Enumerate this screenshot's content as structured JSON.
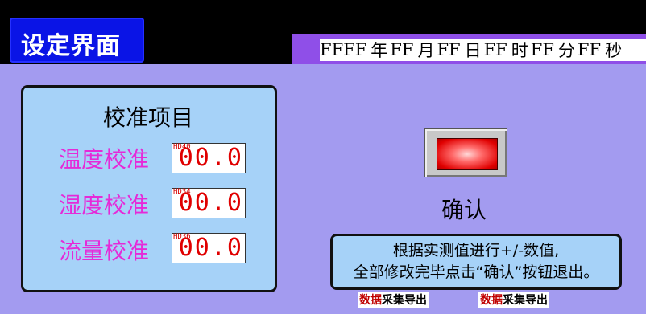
{
  "header": {
    "title": "设定界面"
  },
  "datetime": {
    "year": "FFFF",
    "year_unit": "年",
    "month": "FF",
    "month_unit": "月",
    "day": "FF",
    "day_unit": "日",
    "hour": "FF",
    "hour_unit": "时",
    "minute": "FF",
    "minute_unit": "分",
    "second": "FF",
    "second_unit": "秒"
  },
  "calibration": {
    "title": "校准项目",
    "items": [
      {
        "label": "温度校准",
        "tag": "HD40",
        "value": "00.0"
      },
      {
        "label": "湿度校准",
        "tag": "HD34",
        "value": "00.0"
      },
      {
        "label": "流量校准",
        "tag": "HD36",
        "value": "00.0"
      }
    ]
  },
  "confirm": {
    "label": "确认"
  },
  "note": {
    "line1": "根据实测值进行+/-数值,",
    "line2": "全部修改完毕点击“确认”按钮退出。"
  },
  "export": [
    {
      "prefix": "数据",
      "rest": "采集导出"
    },
    {
      "prefix": "数据",
      "rest": "采集导出"
    }
  ],
  "colors": {
    "title_bg": "#0a14e6",
    "panel_bg": "#a39bf0",
    "label": "#e52ad8",
    "value": "#e00000"
  }
}
